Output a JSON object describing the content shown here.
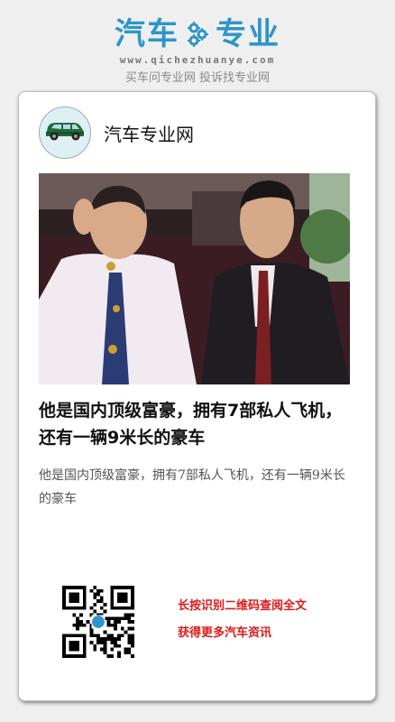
{
  "brand": {
    "name_left": "汽车",
    "name_right": "专业",
    "url": "www.qichezhuanye.com",
    "slogan": "买车问专业网 投诉找专业网",
    "color": "#2f95c9",
    "logo_icon": "gear-icon"
  },
  "card": {
    "site_name": "汽车专业网",
    "avatar_icon": "car-icon",
    "article": {
      "title": "他是国内顶级富豪，拥有7部私人飞机，还有一辆9米长的豪车",
      "summary": "他是国内顶级富豪，拥有7部私人飞机，还有一辆9米长的豪车"
    },
    "cta": {
      "line1": "长按识别二维码查阅全文",
      "line2": "获得更多汽车资讯",
      "color": "#e01818"
    }
  }
}
